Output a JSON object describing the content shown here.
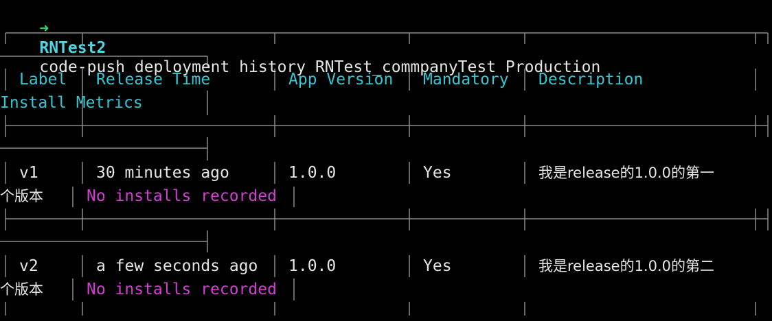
{
  "prompt": {
    "arrow": "➜",
    "directory": "RNTest2",
    "command": "code-push deployment history RNTest_commpanyTest Production"
  },
  "table": {
    "headers": {
      "label": "Label",
      "release_time": "Release Time",
      "app_version": "App Version",
      "mandatory": "Mandatory",
      "description": "Description",
      "install_metrics": "Install Metrics"
    },
    "rows": [
      {
        "label": "v1",
        "release_time": "30 minutes ago",
        "app_version": "1.0.0",
        "mandatory": "Yes",
        "description_line1": "我是release的1.0.0的第一",
        "description_line2": "个版本",
        "install_metrics": "No installs recorded"
      },
      {
        "label": "v2",
        "release_time": "a few seconds ago",
        "app_version": "1.0.0",
        "mandatory": "Yes",
        "description_line1": "我是release的1.0.0的第二",
        "description_line2": "个版本",
        "install_metrics": "No installs recorded"
      }
    ]
  },
  "colors": {
    "background": "#000000",
    "prompt_arrow": "#2fd07a",
    "prompt_dir": "#4fd6e0",
    "header_text": "#33c7d4",
    "metrics_text": "#d23fd2",
    "table_border": "#8a8a8a"
  }
}
